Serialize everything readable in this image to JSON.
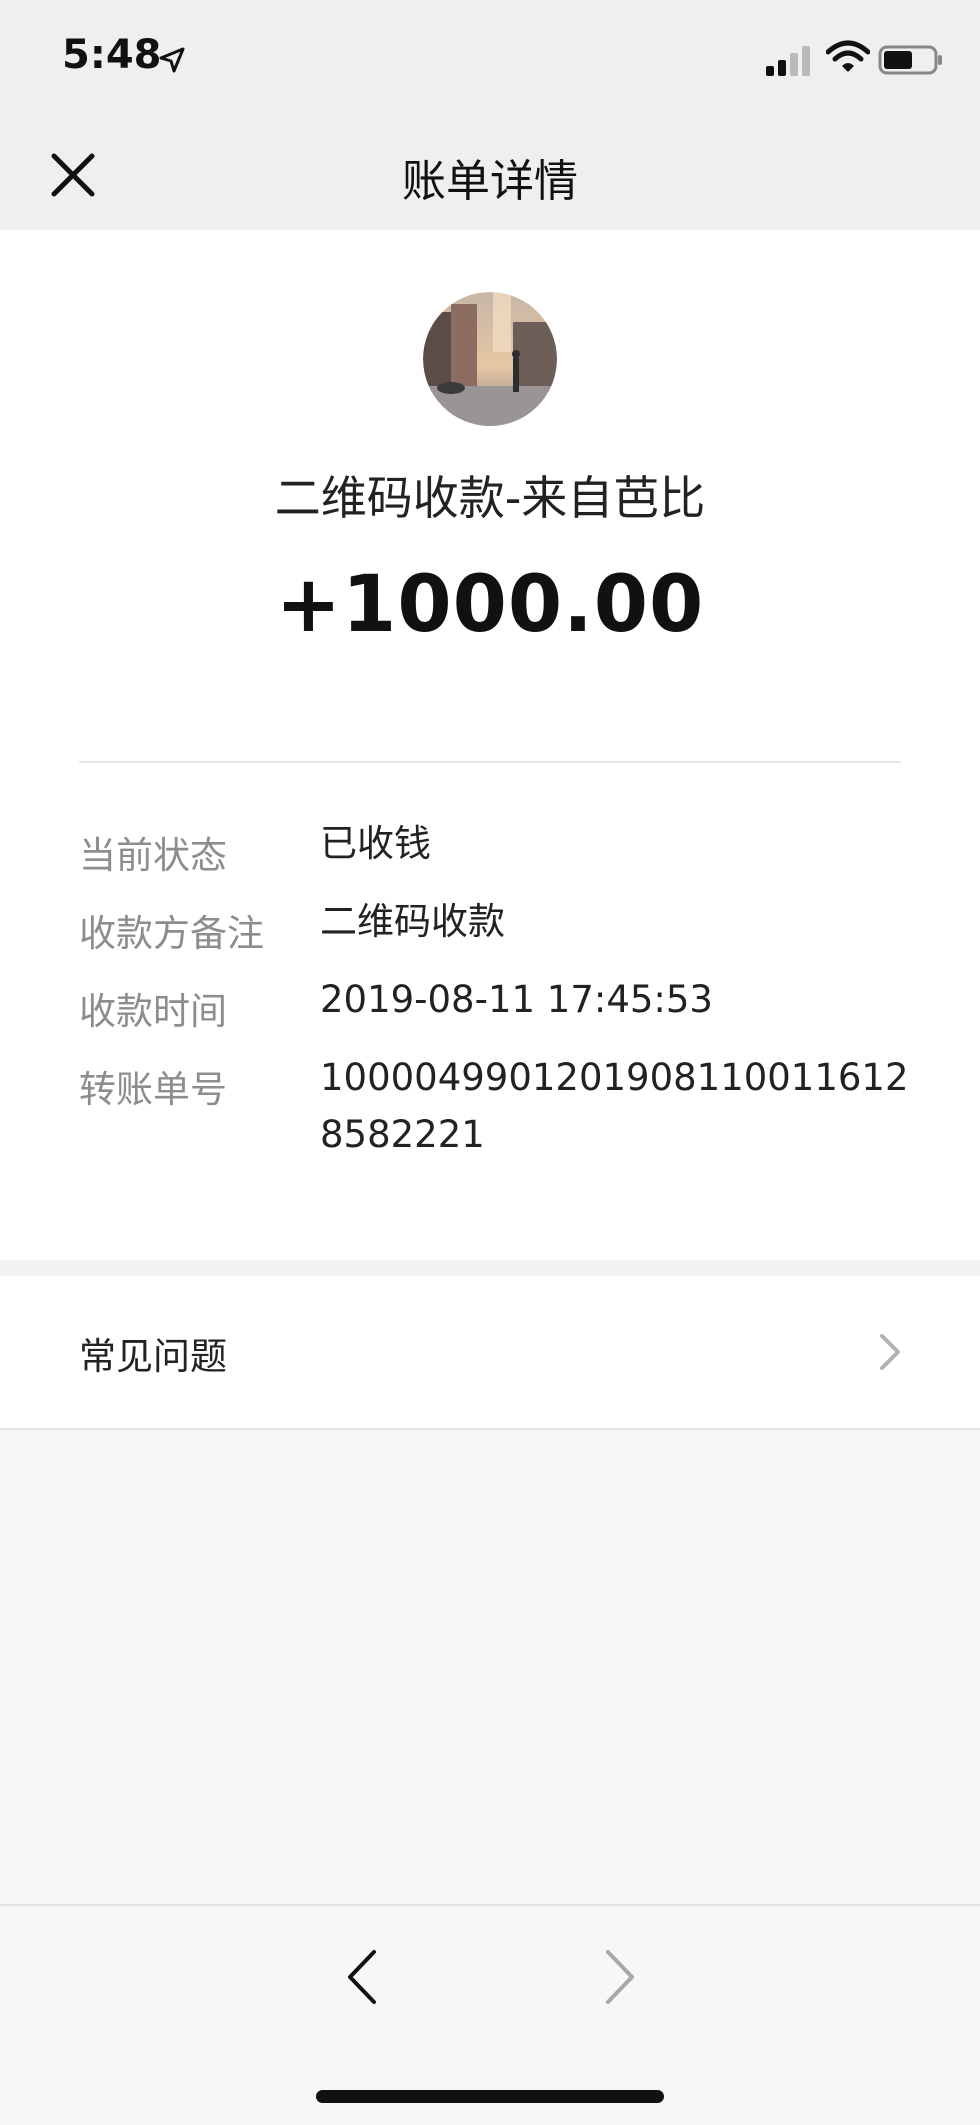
{
  "status_bar": {
    "time": "5:48",
    "icons": [
      "location-arrow-icon",
      "cellular-signal-icon",
      "wifi-icon",
      "battery-icon"
    ]
  },
  "nav": {
    "title": "账单详情",
    "close_icon": "close-icon"
  },
  "transaction": {
    "payer_line": "二维码收款-来自芭比",
    "amount": "+1000.00",
    "details": [
      {
        "label": "当前状态",
        "value": "已收钱"
      },
      {
        "label": "收款方备注",
        "value": "二维码收款"
      },
      {
        "label": "收款时间",
        "value": "2019-08-11 17:45:53"
      },
      {
        "label": "转账单号",
        "value": "10000499012019081100116128582221"
      }
    ]
  },
  "faq": {
    "label": "常见问题",
    "icon": "chevron-right-icon"
  },
  "bottom_nav": {
    "icons": [
      "back-arrow-icon",
      "forward-arrow-icon"
    ]
  },
  "colors": {
    "nav_background": "#efefef",
    "card_background": "#ffffff",
    "label_gray": "#8d8d8d",
    "page_background": "#f6f6f6"
  }
}
